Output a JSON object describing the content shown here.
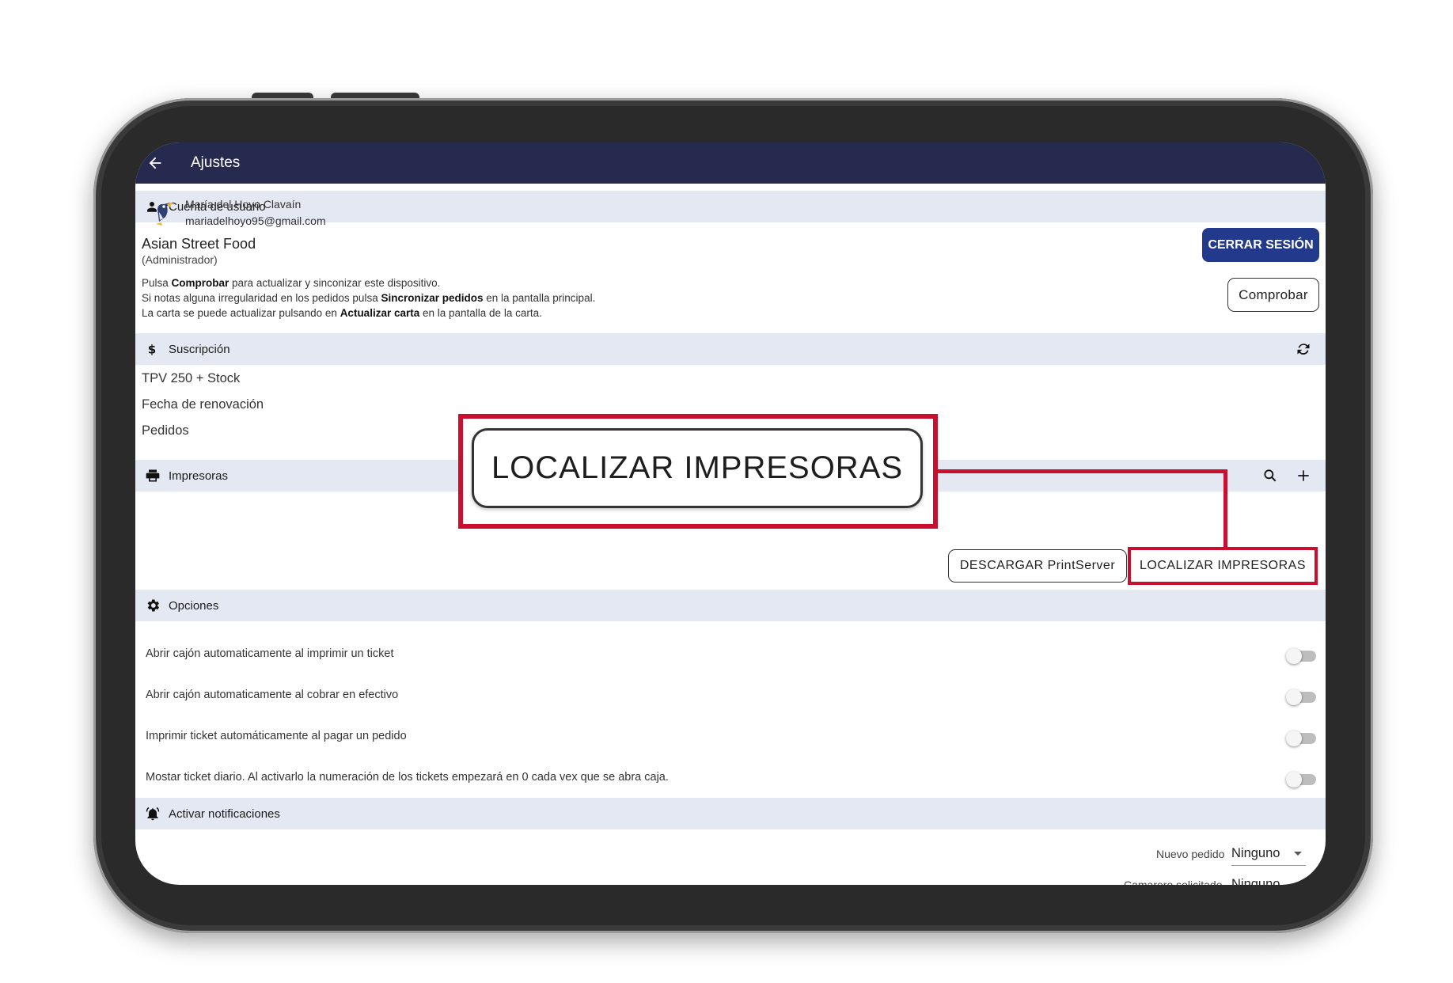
{
  "appbar": {
    "title": "Ajustes",
    "back_icon": "arrow-left-icon"
  },
  "account": {
    "section_label": "Cuenta de usuario",
    "user_name": "María del Hoyo Clavaín",
    "email": "mariadelhoyo95@gmail.com",
    "logout_label": "CERRAR SESIÓN",
    "restaurant_name": "Asian Street Food",
    "role": "(Administrador)",
    "check_label": "Comprobar",
    "info_lines": [
      {
        "pre": "Pulsa ",
        "bold": "Comprobar",
        "post": " para actualizar y sinconizar este dispositivo."
      },
      {
        "pre": "Si notas alguna irregularidad en los pedidos pulsa ",
        "bold": "Sincronizar pedidos",
        "post": " en la pantalla principal."
      },
      {
        "pre": "La carta se puede actualizar pulsando en ",
        "bold": "Actualizar carta",
        "post": " en la pantalla de la carta."
      }
    ]
  },
  "subscription": {
    "section_label": "Suscripción",
    "plan": "TPV 250 + Stock",
    "renewal": "Fecha de renovación",
    "orders": "Pedidos"
  },
  "printers": {
    "section_label": "Impresoras",
    "download_label": "DESCARGAR PrintServer",
    "locate_label": "LOCALIZAR IMPRESORAS"
  },
  "options": {
    "section_label": "Opciones",
    "items": [
      {
        "label": "Abrir cajón automaticamente al imprimir un ticket",
        "enabled": false
      },
      {
        "label": "Abrir cajón automaticamente al cobrar en efectivo",
        "enabled": false
      },
      {
        "label": "Imprimir ticket automáticamente al pagar un pedido",
        "enabled": false
      },
      {
        "label": "Mostar ticket diario. Al activarlo la numeración de los tickets empezará en 0 cada vex que se abra caja.",
        "enabled": false
      }
    ]
  },
  "notifications": {
    "section_label": "Activar notificaciones",
    "items": [
      {
        "label": "Nuevo pedido",
        "value": "Ninguno"
      },
      {
        "label": "Camarero solicitado",
        "value": "Ninguno"
      }
    ]
  },
  "callout": {
    "label": "LOCALIZAR IMPRESORAS",
    "highlight_color": "#c8102e"
  },
  "colors": {
    "appbar": "#252a4e",
    "section_bg": "#e4e8f3",
    "primary_button": "#233a8c"
  }
}
